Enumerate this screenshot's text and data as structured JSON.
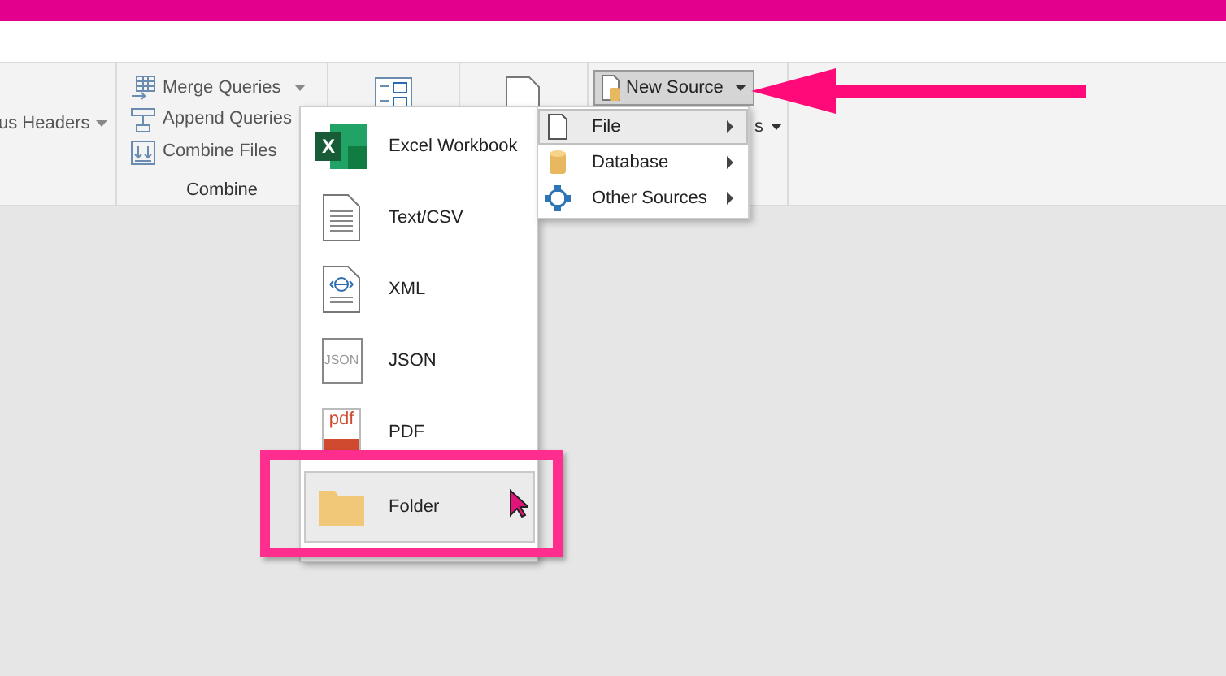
{
  "ribbon": {
    "cut_label": {
      "label": "us Headers",
      "dropdown": true
    },
    "combine": {
      "items": [
        {
          "kind": "merge",
          "label": "Merge Queries",
          "dropdown": true
        },
        {
          "kind": "append",
          "label": "Append Queries",
          "dropdown": false
        },
        {
          "kind": "combine",
          "label": "Combine Files",
          "dropdown": false
        }
      ],
      "title": "Combine"
    },
    "new_source": {
      "label": "New Source",
      "pressed": true
    },
    "hidden_label": {
      "label": "s",
      "dropdown": true
    }
  },
  "file_menu": [
    {
      "kind": "excel",
      "label": "Excel Workbook",
      "icon_text": "X",
      "selected": false
    },
    {
      "kind": "text",
      "label": "Text/CSV",
      "selected": false
    },
    {
      "kind": "xml",
      "label": "XML",
      "selected": false
    },
    {
      "kind": "json",
      "label": "JSON",
      "icon_text": "JSON",
      "selected": false
    },
    {
      "kind": "pdf",
      "label": "PDF",
      "icon_text": "pdf",
      "selected": false
    },
    {
      "kind": "folder",
      "label": "Folder",
      "selected": true
    }
  ],
  "source_menu": [
    {
      "kind": "file",
      "label": "File",
      "selected": true
    },
    {
      "kind": "database",
      "label": "Database",
      "selected": false
    },
    {
      "kind": "other",
      "label": "Other Sources",
      "selected": false
    }
  ]
}
